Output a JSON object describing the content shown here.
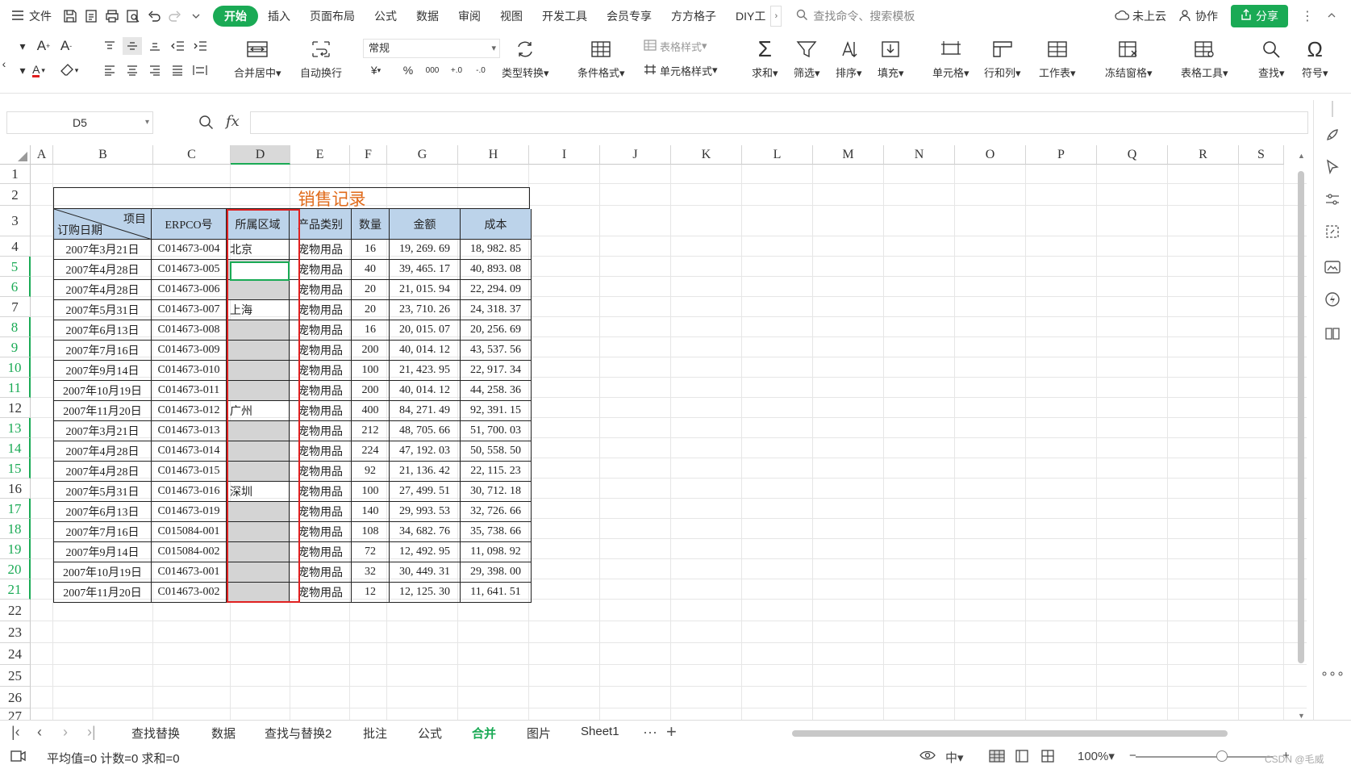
{
  "menu": {
    "file": "文件",
    "tabs": [
      "开始",
      "插入",
      "页面布局",
      "公式",
      "数据",
      "审阅",
      "视图",
      "开发工具",
      "会员专享",
      "方方格子",
      "DIY工"
    ],
    "active_tab": 0,
    "search_placeholder": "查找命令、搜索模板",
    "cloud": "未上云",
    "collab": "协作",
    "share": "分享"
  },
  "ribbon": {
    "merge_center": "合并居中",
    "wrap": "自动换行",
    "number_format": "常规",
    "type_convert": "类型转换",
    "cond_format": "条件格式",
    "table_style": "表格样式",
    "cell_style": "单元格样式",
    "sum": "求和",
    "filter": "筛选",
    "sort": "排序",
    "fill": "填充",
    "cells": "单元格",
    "rows_cols": "行和列",
    "worksheet": "工作表",
    "freeze": "冻结窗格",
    "table_tools": "表格工具",
    "find": "查找",
    "symbol": "符号"
  },
  "formula_bar": {
    "name_box": "D5",
    "fx": "fx",
    "formula": ""
  },
  "columns": [
    "A",
    "B",
    "C",
    "D",
    "E",
    "F",
    "G",
    "H",
    "I",
    "J",
    "K",
    "L",
    "M",
    "N",
    "O",
    "P",
    "Q",
    "R",
    "S"
  ],
  "selected_column": "D",
  "rows": [
    "1",
    "2",
    "3",
    "4",
    "5",
    "6",
    "7",
    "8",
    "9",
    "10",
    "11",
    "12",
    "13",
    "14",
    "15",
    "16",
    "17",
    "18",
    "19",
    "20",
    "21",
    "22",
    "23",
    "24",
    "25",
    "26",
    "27"
  ],
  "green_rows": [
    "5",
    "6",
    "8",
    "9",
    "10",
    "11",
    "13",
    "14",
    "15",
    "17",
    "18",
    "19",
    "20",
    "21"
  ],
  "table": {
    "title": "销售记录",
    "diag_top": "项目",
    "diag_bottom": "订购日期",
    "headers": [
      "ERPCO号",
      "所属区域",
      "产品类别",
      "数量",
      "金额",
      "成本"
    ],
    "rows": [
      {
        "date": "2007年3月21日",
        "code": "C014673-004",
        "region": "北京",
        "cat": "宠物用品",
        "qty": "16",
        "amount": "19, 269. 69",
        "cost": "18, 982. 85"
      },
      {
        "date": "2007年4月28日",
        "code": "C014673-005",
        "region": "",
        "cat": "宠物用品",
        "qty": "40",
        "amount": "39, 465. 17",
        "cost": "40, 893. 08"
      },
      {
        "date": "2007年4月28日",
        "code": "C014673-006",
        "region": "",
        "cat": "宠物用品",
        "qty": "20",
        "amount": "21, 015. 94",
        "cost": "22, 294. 09"
      },
      {
        "date": "2007年5月31日",
        "code": "C014673-007",
        "region": "上海",
        "cat": "宠物用品",
        "qty": "20",
        "amount": "23, 710. 26",
        "cost": "24, 318. 37"
      },
      {
        "date": "2007年6月13日",
        "code": "C014673-008",
        "region": "",
        "cat": "宠物用品",
        "qty": "16",
        "amount": "20, 015. 07",
        "cost": "20, 256. 69"
      },
      {
        "date": "2007年7月16日",
        "code": "C014673-009",
        "region": "",
        "cat": "宠物用品",
        "qty": "200",
        "amount": "40, 014. 12",
        "cost": "43, 537. 56"
      },
      {
        "date": "2007年9月14日",
        "code": "C014673-010",
        "region": "",
        "cat": "宠物用品",
        "qty": "100",
        "amount": "21, 423. 95",
        "cost": "22, 917. 34"
      },
      {
        "date": "2007年10月19日",
        "code": "C014673-011",
        "region": "",
        "cat": "宠物用品",
        "qty": "200",
        "amount": "40, 014. 12",
        "cost": "44, 258. 36"
      },
      {
        "date": "2007年11月20日",
        "code": "C014673-012",
        "region": "广州",
        "cat": "宠物用品",
        "qty": "400",
        "amount": "84, 271. 49",
        "cost": "92, 391. 15"
      },
      {
        "date": "2007年3月21日",
        "code": "C014673-013",
        "region": "",
        "cat": "宠物用品",
        "qty": "212",
        "amount": "48, 705. 66",
        "cost": "51, 700. 03"
      },
      {
        "date": "2007年4月28日",
        "code": "C014673-014",
        "region": "",
        "cat": "宠物用品",
        "qty": "224",
        "amount": "47, 192. 03",
        "cost": "50, 558. 50"
      },
      {
        "date": "2007年4月28日",
        "code": "C014673-015",
        "region": "",
        "cat": "宠物用品",
        "qty": "92",
        "amount": "21, 136. 42",
        "cost": "22, 115. 23"
      },
      {
        "date": "2007年5月31日",
        "code": "C014673-016",
        "region": "深圳",
        "cat": "宠物用品",
        "qty": "100",
        "amount": "27, 499. 51",
        "cost": "30, 712. 18"
      },
      {
        "date": "2007年6月13日",
        "code": "C014673-019",
        "region": "",
        "cat": "宠物用品",
        "qty": "140",
        "amount": "29, 993. 53",
        "cost": "32, 726. 66"
      },
      {
        "date": "2007年7月16日",
        "code": "C015084-001",
        "region": "",
        "cat": "宠物用品",
        "qty": "108",
        "amount": "34, 682. 76",
        "cost": "35, 738. 66"
      },
      {
        "date": "2007年9月14日",
        "code": "C015084-002",
        "region": "",
        "cat": "宠物用品",
        "qty": "72",
        "amount": "12, 492. 95",
        "cost": "11, 098. 92"
      },
      {
        "date": "2007年10月19日",
        "code": "C014673-001",
        "region": "",
        "cat": "宠物用品",
        "qty": "32",
        "amount": "30, 449. 31",
        "cost": "29, 398. 00"
      },
      {
        "date": "2007年11月20日",
        "code": "C014673-002",
        "region": "",
        "cat": "宠物用品",
        "qty": "12",
        "amount": "12, 125. 30",
        "cost": "11, 641. 51"
      }
    ]
  },
  "sheet_tabs": [
    "查找替换",
    "数据",
    "查找与替换2",
    "批注",
    "公式",
    "合并",
    "图片",
    "Sheet1"
  ],
  "active_sheet": "合并",
  "status": {
    "summary": "平均值=0  计数=0  求和=0",
    "zoom": "100%",
    "watermark": "CSDN @毛威"
  }
}
